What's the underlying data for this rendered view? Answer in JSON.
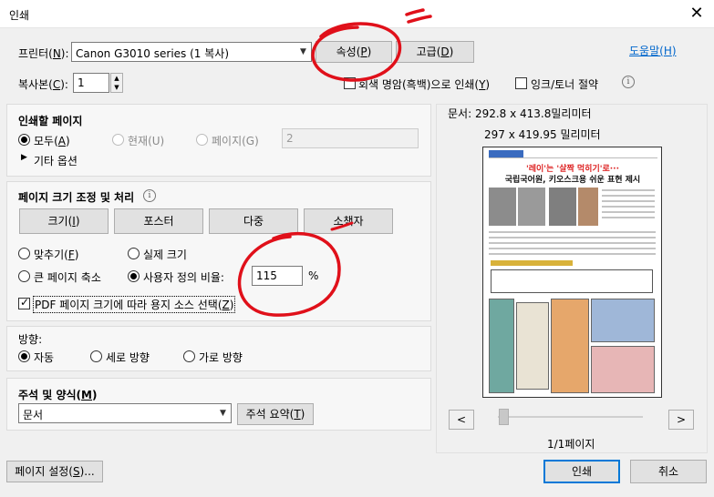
{
  "window": {
    "title": "인쇄",
    "close_glyph": "✕"
  },
  "printer": {
    "label": "프린터(",
    "label_key": "N",
    "label_end": "):",
    "selected": "Canon G3010 series (1 복사)",
    "properties_btn": "속성(",
    "properties_key": "P",
    "properties_end": ")",
    "advanced_btn": "고급(",
    "advanced_key": "D",
    "advanced_end": ")",
    "help_link": "도움말(",
    "help_key": "H",
    "help_end": ")"
  },
  "copies": {
    "label": "복사본(",
    "label_key": "C",
    "label_end": "):",
    "value": "1",
    "grayscale_label": "회색 명암(흑백)으로 인쇄(",
    "grayscale_key": "Y",
    "grayscale_end": ")",
    "ink_save_label": "잉크/토너 절약"
  },
  "pages_to_print": {
    "heading": "인쇄할 페이지",
    "all": "모두(",
    "all_key": "A",
    "all_end": ")",
    "current": "현재(U)",
    "pages": "페이지(G)",
    "pages_value": "2",
    "more_options": "기타 옵션"
  },
  "sizing": {
    "heading": "페이지 크기 조정 및 처리",
    "btn_size": "크기(",
    "btn_size_key": "I",
    "btn_size_end": ")",
    "btn_poster": "포스터",
    "btn_multiple": "다중",
    "btn_booklet": "소책자",
    "fit": "맞추기(",
    "fit_key": "F",
    "fit_end": ")",
    "actual_size": "실제 크기",
    "shrink": "큰 페이지 축소",
    "custom_scale": "사용자 정의 비율:",
    "custom_scale_value": "115",
    "percent": "%",
    "paper_source": "PDF 페이지 크기에 따라 용지 소스 선택(",
    "paper_source_key": "Z",
    "paper_source_end": ")"
  },
  "orientation": {
    "heading": "방향:",
    "auto": "자동",
    "portrait": "세로 방향",
    "landscape": "가로 방향"
  },
  "comments": {
    "heading": "주석 및 양식(",
    "heading_key": "M",
    "heading_end": ")",
    "selected": "문서",
    "summarize_btn": "주석 요약(",
    "summarize_key": "T",
    "summarize_end": ")"
  },
  "preview": {
    "doc_size": "문서: 292.8 x 413.8밀리미터",
    "paper_size": "297 x 419.95 밀리미터",
    "page_count": "1/1페이지",
    "prev": "<",
    "next": ">",
    "headline1": "'레이'는 '살짝 먹히기'로···",
    "headline2": "국립국어원, 키오스크용 쉬운 표현 제시"
  },
  "footer": {
    "page_setup": "페이지 설정(",
    "page_setup_key": "S",
    "page_setup_end": ")...",
    "print": "인쇄",
    "cancel": "취소"
  },
  "colors": {
    "accent": "#0078d7",
    "annotation": "#e0101a"
  }
}
